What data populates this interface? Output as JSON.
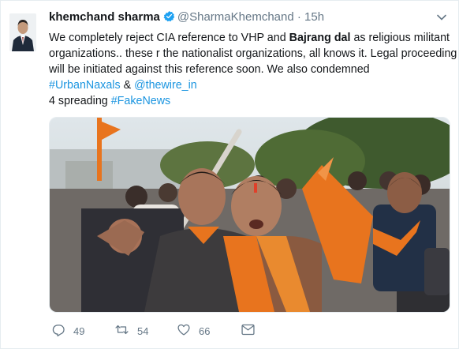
{
  "tweet": {
    "display_name": "khemchand sharma",
    "handle": "@SharmaKhemchand",
    "separator": "·",
    "time": "15h",
    "text": {
      "line1_a": "We completely reject CIA reference to VHP and ",
      "line1_bold": "Bajrang dal",
      "line1_b": " as religious militant",
      "line2": "organizations.. these r the nationalist organizations, all knows it. Legal proceeding",
      "line3": "will be initiated against this reference soon. We also condemned",
      "hashtag1": "#UrbanNaxals",
      "amp": " & ",
      "mention": "@thewire_in",
      "line5_a": "4 spreading ",
      "hashtag2": "#FakeNews"
    }
  },
  "actions": {
    "replies": "49",
    "retweets": "54",
    "likes": "66"
  },
  "colors": {
    "link": "#1b95e0",
    "verified": "#1da1f2",
    "muted": "#657786",
    "saffron": "#e8741e"
  },
  "icons": [
    "verified-badge-icon",
    "chevron-down-icon",
    "reply-icon",
    "retweet-icon",
    "like-icon",
    "direct-message-icon"
  ]
}
